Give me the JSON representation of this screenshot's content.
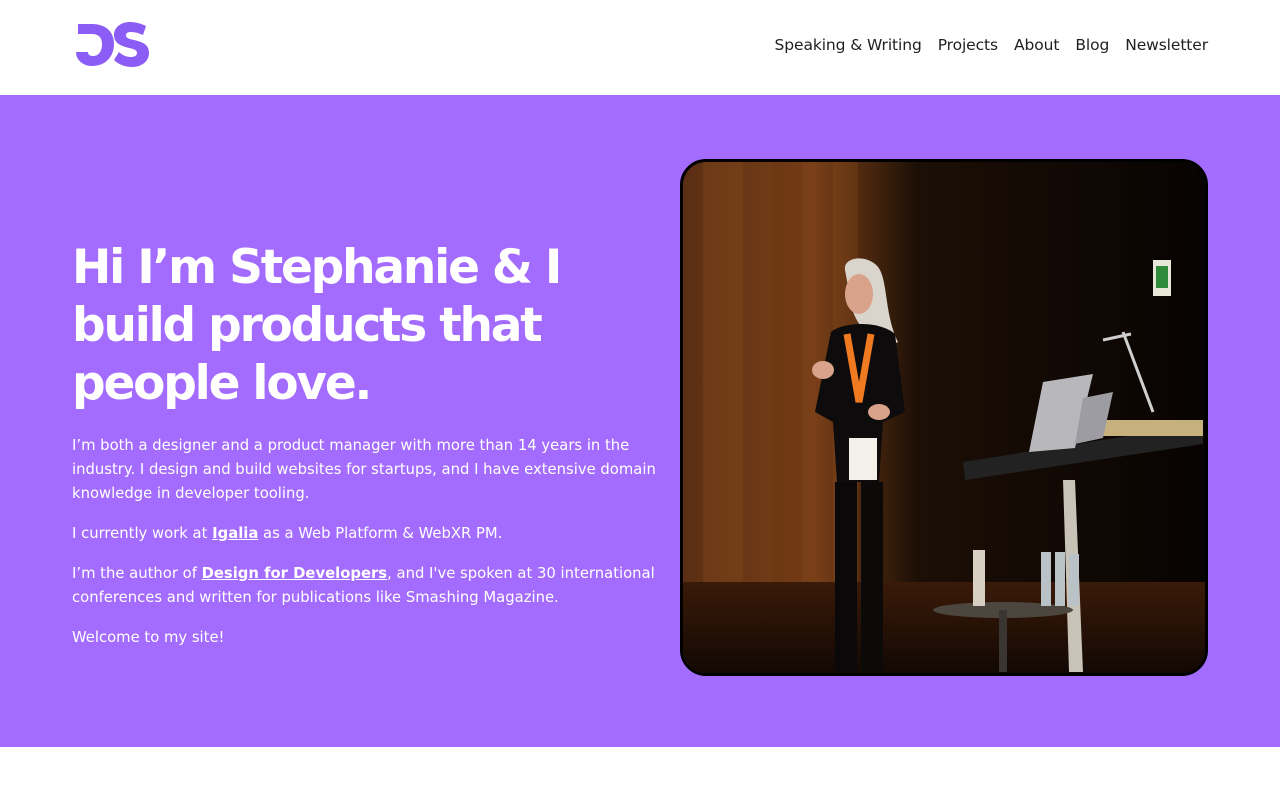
{
  "logo": {
    "icon": "ds-monogram-logo",
    "color": "#8b5cf6"
  },
  "nav": {
    "items": [
      {
        "label": "Speaking & Writing"
      },
      {
        "label": "Projects"
      },
      {
        "label": "About"
      },
      {
        "label": "Blog"
      },
      {
        "label": "Newsletter"
      }
    ]
  },
  "hero": {
    "background": "#a36bfe",
    "title": "Hi I’m Stephanie & I build products that people love.",
    "p1": "I’m both a designer and a product manager with more than 14 years in the industry. I design and build websites for startups, and I have extensive domain knowledge in developer tooling.",
    "p2": {
      "before": "I currently work at ",
      "link": "Igalia",
      "after": " as a Web Platform & WebXR PM."
    },
    "p3": {
      "before": "I’m the author of ",
      "link": "Design for Developers",
      "after": ", and I've spoken at 30 international conferences and written for publications like Smashing Magazine."
    },
    "p4": "Welcome to my site!",
    "photo": {
      "subject": "speaker-on-stage-photo"
    }
  }
}
